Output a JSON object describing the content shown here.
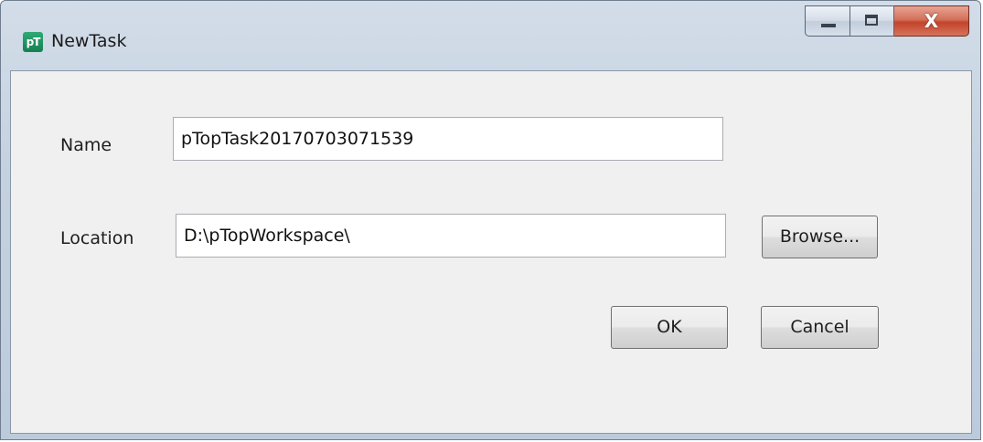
{
  "window": {
    "title": "NewTask",
    "app_icon_text": "pT",
    "controls": {
      "minimize": "minimize",
      "maximize": "maximize",
      "close_glyph": "X"
    }
  },
  "form": {
    "name_label": "Name",
    "name_value": "pTopTask20170703071539",
    "location_label": "Location",
    "location_value": "D:\\pTopWorkspace\\",
    "browse_label": "Browse...",
    "ok_label": "OK",
    "cancel_label": "Cancel"
  },
  "icons": [
    "app-icon",
    "minimize-icon",
    "maximize-icon",
    "close-icon"
  ],
  "colors": {
    "titlebar": "#c4d1e0",
    "client_bg": "#f0f0f0",
    "close_button": "#c2442a",
    "app_icon": "#1e9461"
  }
}
